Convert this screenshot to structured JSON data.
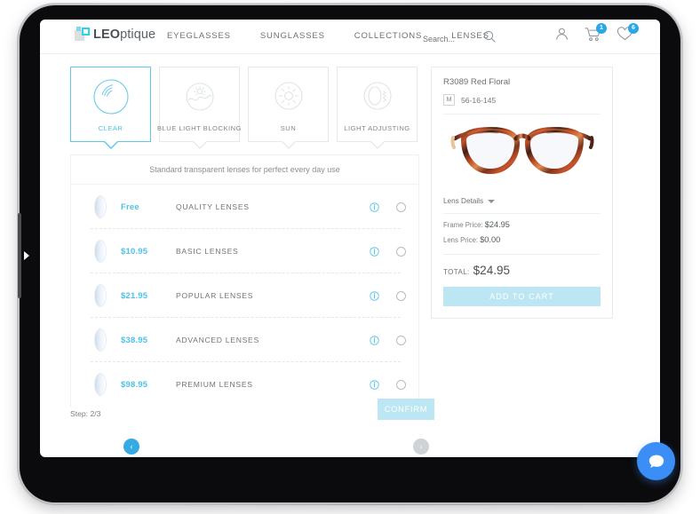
{
  "header": {
    "logo_text_bold": "LEO",
    "logo_text_light": "ptique",
    "nav": [
      {
        "label": "EYEGLASSES",
        "name": "nav-eyeglasses"
      },
      {
        "label": "SUNGLASSES",
        "name": "nav-sunglasses"
      },
      {
        "label": "COLLECTIONS",
        "name": "nav-collections"
      },
      {
        "label": "LENSES",
        "name": "nav-lenses"
      }
    ],
    "search": {
      "placeholder": "Search...",
      "value": ""
    },
    "cart_count": "1",
    "wishlist_count": "6"
  },
  "lens_types": [
    {
      "label": "CLEAR",
      "icon": "clear-lens-icon",
      "active": true
    },
    {
      "label": "BLUE LIGHT BLOCKING",
      "icon": "blue-light-icon",
      "active": false
    },
    {
      "label": "SUN",
      "icon": "sun-icon",
      "active": false
    },
    {
      "label": "LIGHT ADJUSTING",
      "icon": "light-adjusting-icon",
      "active": false
    }
  ],
  "lens_panel": {
    "description": "Standard transparent lenses for perfect every day use",
    "rows": [
      {
        "price": "Free",
        "name": "QUALITY LENSES",
        "selected": false
      },
      {
        "price": "$10.95",
        "name": "BASIC LENSES",
        "selected": false
      },
      {
        "price": "$21.95",
        "name": "POPULAR LENSES",
        "selected": false
      },
      {
        "price": "$38.95",
        "name": "ADVANCED LENSES",
        "selected": false
      },
      {
        "price": "$98.95",
        "name": "PREMIUM LENSES",
        "selected": false
      }
    ]
  },
  "product": {
    "title": "R3089 Red Floral",
    "size_badge": "M",
    "dimensions": "56-16-145",
    "lens_details_label": "Lens Details",
    "frame_price_label": "Frame Price:",
    "frame_price_value": "$24.95",
    "lens_price_label": "Lens Price:",
    "lens_price_value": "$0.00",
    "total_label": "TOTAL:",
    "total_value": "$24.95",
    "add_to_cart_label": "ADD TO CART"
  },
  "footer": {
    "step_text": "Step: 2/3",
    "confirm_label": "CONFIRM",
    "prev_arrow": "‹",
    "next_arrow": "›"
  },
  "colors": {
    "accent_cyan": "#4fc1e9",
    "button_light_blue": "#bce6f4",
    "badge_blue": "#29a7e8",
    "chat_blue": "#3a8ef6"
  }
}
